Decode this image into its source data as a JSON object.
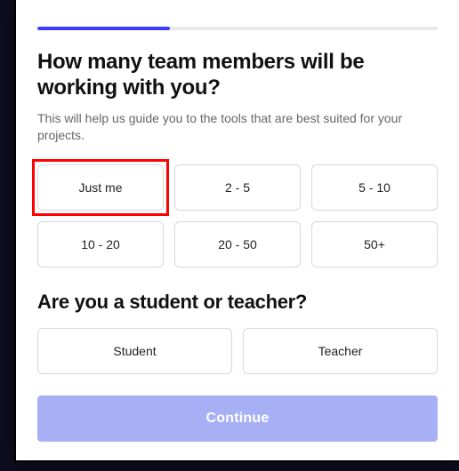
{
  "progress": {
    "percent": 33
  },
  "q1": {
    "title": "How many team members will be working with you?",
    "hint": "This will help us guide you to the tools that are best suited for your projects.",
    "options": [
      "Just me",
      "2 - 5",
      "5 - 10",
      "10 - 20",
      "20 - 50",
      "50+"
    ],
    "highlighted_index": 0
  },
  "q2": {
    "title": "Are you a student or teacher?",
    "options": [
      "Student",
      "Teacher"
    ]
  },
  "cta": {
    "label": "Continue"
  }
}
